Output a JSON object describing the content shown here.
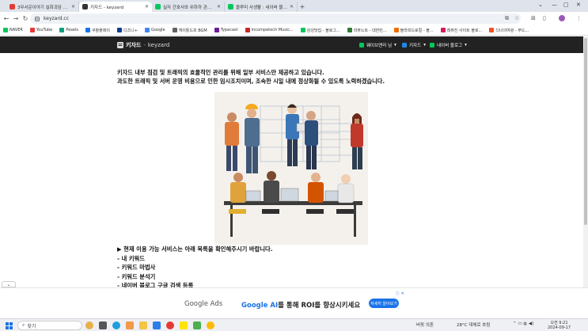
{
  "browser": {
    "tabs": [
      {
        "title": "3무서운이야기 실화괴담 모음",
        "color": "#e53935",
        "active": false
      },
      {
        "title": "키자드 - keyzard",
        "color": "#333333",
        "active": true
      },
      {
        "title": "실자 간호사와 위하하 관리하는 법",
        "color": "#03c75a",
        "active": false
      },
      {
        "title": "블루미 사생활 : 네이버 블로그",
        "color": "#03c75a",
        "active": false
      }
    ],
    "url": "keyzard.cc",
    "bookmarks": [
      {
        "label": "NAVER",
        "color": "#03c75a"
      },
      {
        "label": "YouTube",
        "color": "#e53935"
      },
      {
        "label": "Pexels",
        "color": "#05a081"
      },
      {
        "label": "쿠팡플레이",
        "color": "#1a73e8"
      },
      {
        "label": "디즈니+",
        "color": "#0a3d91"
      },
      {
        "label": "Google",
        "color": "#4285f4"
      },
      {
        "label": "캐이툴드프 BGM",
        "color": "#5f6368"
      },
      {
        "label": "Typecast",
        "color": "#6a1b9a"
      },
      {
        "label": "Incompetech Music...",
        "color": "#c62828"
      },
      {
        "label": "감성맛집 - 블로그...",
        "color": "#03c75a"
      },
      {
        "label": "리뷰노트 - 대한민...",
        "color": "#2e7d32"
      },
      {
        "label": "블라피드로컬 - 블...",
        "color": "#ef6c00"
      },
      {
        "label": "레뷰진 사이트 블로...",
        "color": "#d81b60"
      },
      {
        "label": "디너의여왕 - 푸드...",
        "color": "#f4511e"
      }
    ]
  },
  "site": {
    "brand": "키자드",
    "brand_sep": "-",
    "brand_sub": "keyzard",
    "menu": [
      {
        "label": "웨이브앤리 님",
        "color": "#03c75a"
      },
      {
        "label": "키자드",
        "color": "#1e88e5"
      },
      {
        "label": "네이버 블로그",
        "color": "#03c75a"
      }
    ],
    "notice_line1": "키자드 내부 점검 및 트래픽의 효율적인 관리를 위해 일부 서비스만 제공하고 있습니다.",
    "notice_line2": "과도한 트래픽 및 서버 운영 비용으로 인한 임시조치이며, 조속한 시일 내에 정상화될 수 있도록 노력하겠습니다.",
    "services_heading": "▶ 현재 이용 가능 서비스는 아래 목록을 확인해주시기 바랍니다.",
    "services": [
      "- 내 키워드",
      "- 키워드 마법사",
      "- 키워드 분석기",
      "- 네이버 블로그 구글 검색 등록"
    ]
  },
  "ad": {
    "logo": "Google Ads",
    "text_highlight": "Google AI",
    "text_rest": "를 통해 ROI를 향상시키세요",
    "button": "자세히 알아보기",
    "close": "ⓘ ✕"
  },
  "taskbar": {
    "search_placeholder": "찾기",
    "news": "버핏 의혼",
    "weather": "28°C 대체로 흐림",
    "time": "오전 9:21",
    "date": "2024-09-17"
  },
  "icons": {
    "back": "←",
    "forward": "→",
    "reload": "↻",
    "new_tab": "+",
    "collapse": "⌄"
  }
}
